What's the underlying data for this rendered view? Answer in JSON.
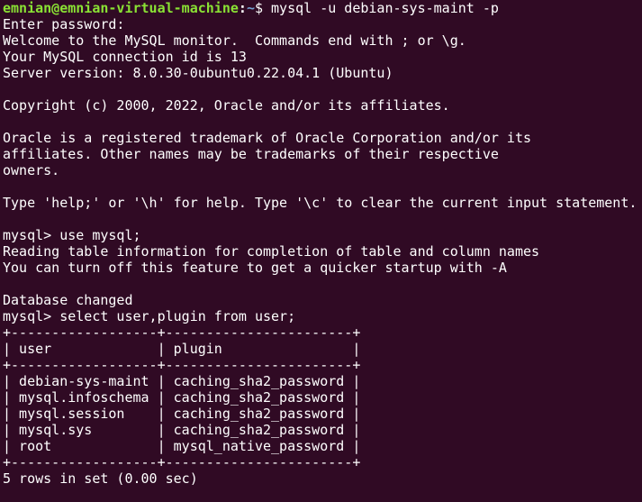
{
  "colors": {
    "background": "#300a24",
    "text": "#ffffff",
    "prompt_user_host": "#8ae234",
    "prompt_path": "#729fcf"
  },
  "terminal": {
    "top_partial": "'/'/   ',','/',/',/',/'",
    "shell_prompt": {
      "user_host": "emnian@emnian-virtual-machine",
      "separator": ":",
      "path": "~",
      "symbol": "$",
      "command": " mysql -u debian-sys-maint -p"
    },
    "login_output": [
      "Enter password:",
      "Welcome to the MySQL monitor.  Commands end with ; or \\g.",
      "Your MySQL connection id is 13",
      "Server version: 8.0.30-0ubuntu0.22.04.1 (Ubuntu)"
    ],
    "copyright": "Copyright (c) 2000, 2022, Oracle and/or its affiliates.",
    "trademark": [
      "Oracle is a registered trademark of Oracle Corporation and/or its",
      "affiliates. Other names may be trademarks of their respective",
      "owners."
    ],
    "help_line": "Type 'help;' or '\\h' for help. Type '\\c' to clear the current input statement.",
    "mysql_prompt": "mysql> ",
    "command_use": "use mysql;",
    "use_output": [
      "Reading table information for completion of table and column names",
      "You can turn off this feature to get a quicker startup with -A"
    ],
    "database_changed": "Database changed",
    "command_select": "select user,plugin from user;",
    "table": {
      "border": "+------------------+-----------------------+",
      "header": "| user             | plugin                |",
      "rows": [
        "| debian-sys-maint | caching_sha2_password |",
        "| mysql.infoschema | caching_sha2_password |",
        "| mysql.session    | caching_sha2_password |",
        "| mysql.sys        | caching_sha2_password |",
        "| root             | mysql_native_password |"
      ]
    },
    "result_summary": "5 rows in set (0.00 sec)"
  }
}
